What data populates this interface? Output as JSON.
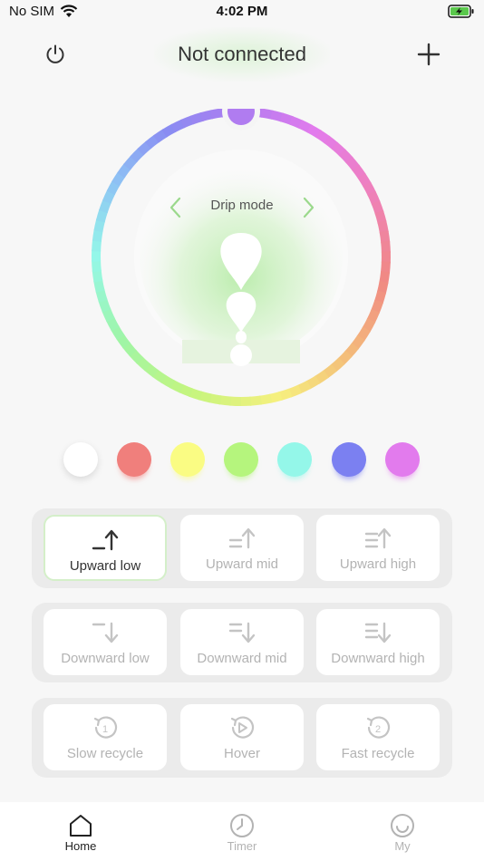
{
  "status": {
    "carrier": "No SIM",
    "time": "4:02 PM"
  },
  "header": {
    "title": "Not connected"
  },
  "wheel": {
    "mode": "Drip mode",
    "selected_color": "#b07cf0"
  },
  "swatches": [
    {
      "name": "white",
      "color": "#ffffff"
    },
    {
      "name": "red",
      "color": "#f07f7c"
    },
    {
      "name": "yellow",
      "color": "#fafc83"
    },
    {
      "name": "green",
      "color": "#b5f57d"
    },
    {
      "name": "cyan",
      "color": "#94f7e9"
    },
    {
      "name": "blue",
      "color": "#7b80f1"
    },
    {
      "name": "purple",
      "color": "#e27bed"
    }
  ],
  "modes": {
    "upward": [
      {
        "label": "Upward low",
        "icon": "upward-low-icon",
        "selected": true
      },
      {
        "label": "Upward mid",
        "icon": "upward-mid-icon",
        "selected": false
      },
      {
        "label": "Upward high",
        "icon": "upward-high-icon",
        "selected": false
      }
    ],
    "downward": [
      {
        "label": "Downward low",
        "icon": "downward-low-icon"
      },
      {
        "label": "Downward mid",
        "icon": "downward-mid-icon"
      },
      {
        "label": "Downward high",
        "icon": "downward-high-icon"
      }
    ],
    "recycle": [
      {
        "label": "Slow recycle",
        "icon": "slow-recycle-icon"
      },
      {
        "label": "Hover",
        "icon": "hover-icon"
      },
      {
        "label": "Fast recycle",
        "icon": "fast-recycle-icon"
      }
    ]
  },
  "tabs": [
    {
      "label": "Home",
      "icon": "home-icon",
      "active": true
    },
    {
      "label": "Timer",
      "icon": "clock-icon",
      "active": false
    },
    {
      "label": "My",
      "icon": "smiley-icon",
      "active": false
    }
  ]
}
